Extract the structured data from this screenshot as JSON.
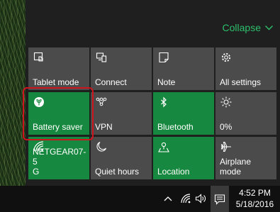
{
  "header": {
    "collapse_label": "Collapse"
  },
  "tiles": [
    {
      "label": "Tablet mode",
      "icon": "tablet-mode-icon",
      "active": false
    },
    {
      "label": "Connect",
      "icon": "connect-icon",
      "active": false
    },
    {
      "label": "Note",
      "icon": "note-icon",
      "active": false
    },
    {
      "label": "All settings",
      "icon": "gear-icon",
      "active": false
    },
    {
      "label": "Battery saver",
      "icon": "battery-saver-icon",
      "active": true
    },
    {
      "label": "VPN",
      "icon": "vpn-icon",
      "active": false
    },
    {
      "label": "Bluetooth",
      "icon": "bluetooth-icon",
      "active": true
    },
    {
      "label": "0%",
      "icon": "brightness-icon",
      "active": false
    },
    {
      "label": "NETGEAR07-5\nG",
      "icon": "wifi-icon",
      "active": true
    },
    {
      "label": "Quiet hours",
      "icon": "moon-icon",
      "active": false
    },
    {
      "label": "Location",
      "icon": "location-icon",
      "active": true
    },
    {
      "label": "Airplane mode",
      "icon": "airplane-icon",
      "active": false
    }
  ],
  "taskbar": {
    "time": "4:52 PM",
    "date": "5/18/2016",
    "tray_icons": [
      "chevron-up-icon",
      "network-icon",
      "volume-icon",
      "action-center-icon"
    ]
  },
  "colors": {
    "accent_green": "#17883f",
    "collapse_green": "#2dbf6b",
    "tile_gray": "#4b4b4b",
    "highlight_red": "#d0141e"
  }
}
